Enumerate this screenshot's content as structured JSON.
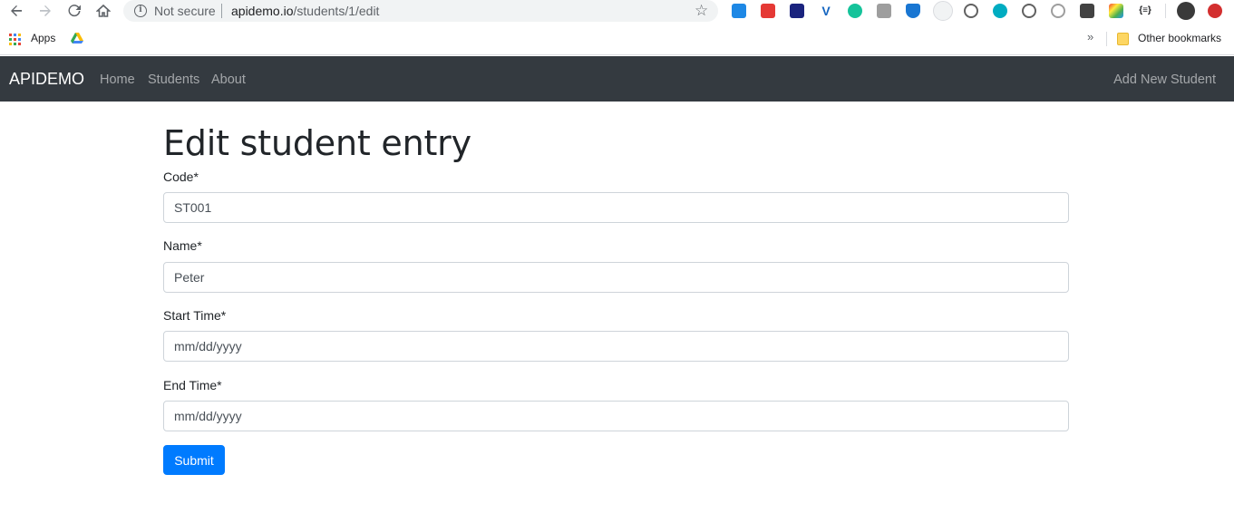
{
  "browser": {
    "not_secure": "Not secure",
    "url_host": "apidemo.io",
    "url_path": "/students/1/edit",
    "bookmarks": {
      "apps": "Apps",
      "other": "Other bookmarks"
    }
  },
  "navbar": {
    "brand": "APIDEMO",
    "links": [
      "Home",
      "Students",
      "About"
    ],
    "right_link": "Add New Student"
  },
  "form": {
    "title": "Edit student entry",
    "fields": [
      {
        "label": "Code*",
        "value": "ST001",
        "placeholder": ""
      },
      {
        "label": "Name*",
        "value": "Peter",
        "placeholder": ""
      },
      {
        "label": "Start Time*",
        "value": "",
        "placeholder": "mm/dd/yyyy"
      },
      {
        "label": "End Time*",
        "value": "",
        "placeholder": "mm/dd/yyyy"
      }
    ],
    "submit_label": "Submit"
  },
  "colors": {
    "navbar_bg": "#343a40",
    "primary": "#007bff"
  }
}
